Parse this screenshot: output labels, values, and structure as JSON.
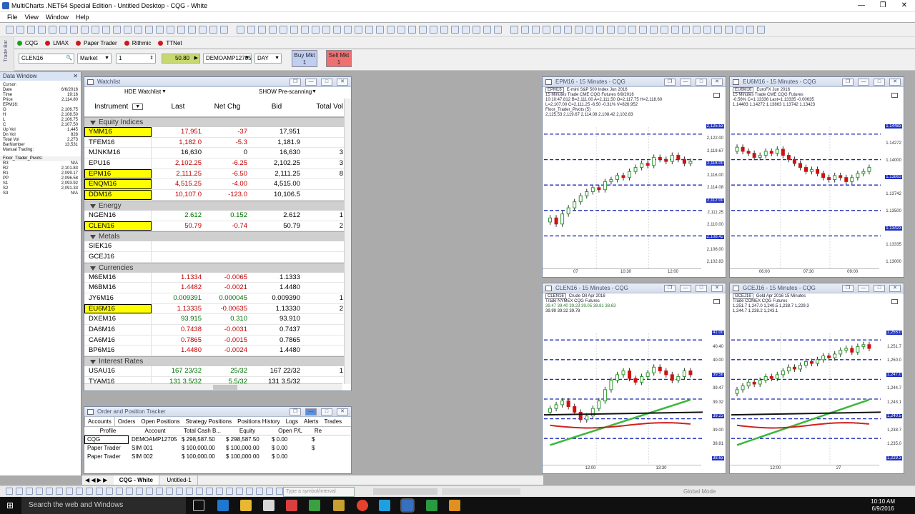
{
  "window": {
    "title": "MultiCharts .NET64 Special Edition - Untitled Desktop - CQG - White"
  },
  "menu": [
    "File",
    "View",
    "Window",
    "Help"
  ],
  "connections": [
    {
      "label": "CQG",
      "color": "#1aa020"
    },
    {
      "label": "LMAX",
      "color": "#d01818"
    },
    {
      "label": "Paper Trader",
      "color": "#d01818"
    },
    {
      "label": "Rithmic",
      "color": "#d01818"
    },
    {
      "label": "TTNet",
      "color": "#d01818"
    }
  ],
  "trade_bar": {
    "symbol": "CLEN16",
    "order_type": "Market",
    "quantity": "1",
    "price": "50.80",
    "account": "DEMOAMP12705",
    "tif": "DAY",
    "buy_label": "Buy Mkt",
    "buy_qty": "1",
    "sell_label": "Sell Mkt",
    "sell_qty": "1",
    "side_label": "Trade Bar"
  },
  "data_window": {
    "title": "Data Window",
    "rows": [
      {
        "k": "Cursor:",
        "v": ""
      },
      {
        "k": "Date",
        "v": "6/6/2016"
      },
      {
        "k": "Time",
        "v": "19:16"
      },
      {
        "k": "Price",
        "v": "2,114.80"
      },
      {
        "k": "EPM16:",
        "v": ""
      },
      {
        "k": "O",
        "v": "2,106.75"
      },
      {
        "k": "H",
        "v": "2,108.50"
      },
      {
        "k": "L",
        "v": "2,106.75"
      },
      {
        "k": "C",
        "v": "2,107.50"
      },
      {
        "k": "Up Vol",
        "v": "1,445"
      },
      {
        "k": "Dn Vol",
        "v": "828"
      },
      {
        "k": "Total Vol",
        "v": "2,273"
      },
      {
        "k": "BarNumber",
        "v": "13,531"
      },
      {
        "k": "Manual Trading:",
        "v": ""
      }
    ],
    "pivot_title": "Floor_Trader_Pivots:",
    "pivots": [
      {
        "k": "R3",
        "v": "N/A"
      },
      {
        "k": "R2",
        "v": "2,101.83"
      },
      {
        "k": "R1",
        "v": "2,099.17"
      },
      {
        "k": "PP",
        "v": "2,096.58"
      },
      {
        "k": "S1",
        "v": "2,093.92"
      },
      {
        "k": "S2",
        "v": "2,091.33"
      },
      {
        "k": "S3",
        "v": "N/A"
      }
    ]
  },
  "watchlist": {
    "title": "Watchlist",
    "name": "HDE Watchlist",
    "prescan": "SHOW Pre-scanning",
    "columns": [
      "Instrument",
      "Last",
      "Net Chg",
      "Bid",
      "Total Vol"
    ],
    "groups": [
      {
        "name": "Equity Indices",
        "rows": [
          {
            "inst": "YMM16",
            "last": "17,951",
            "chg": "-37",
            "bid": "17,951",
            "vol": "",
            "hl": true,
            "c": "red"
          },
          {
            "inst": "TFEM16",
            "last": "1,182.0",
            "chg": "-5.3",
            "bid": "1,181.9",
            "vol": "",
            "hl": false,
            "c": "red"
          },
          {
            "inst": "MJNKM16",
            "last": "16,630",
            "chg": "0",
            "bid": "16,630",
            "vol": "3",
            "hl": false,
            "c": ""
          },
          {
            "inst": "EPU16",
            "last": "2,102.25",
            "chg": "-6.25",
            "bid": "2,102.25",
            "vol": "3",
            "hl": false,
            "c": "red"
          },
          {
            "inst": "EPM16",
            "last": "2,111.25",
            "chg": "-6.50",
            "bid": "2,111.25",
            "vol": "8",
            "hl": true,
            "c": "red"
          },
          {
            "inst": "ENQM16",
            "last": "4,515.25",
            "chg": "-4.00",
            "bid": "4,515.00",
            "vol": "",
            "hl": true,
            "c": "red"
          },
          {
            "inst": "DDM16",
            "last": "10,107.0",
            "chg": "-123.0",
            "bid": "10,106.5",
            "vol": "",
            "hl": true,
            "c": "red"
          }
        ]
      },
      {
        "name": "Energy",
        "rows": [
          {
            "inst": "NGEN16",
            "last": "2.612",
            "chg": "0.152",
            "bid": "2.612",
            "vol": "1",
            "hl": false,
            "c": "grn"
          },
          {
            "inst": "CLEN16",
            "last": "50.79",
            "chg": "-0.74",
            "bid": "50.79",
            "vol": "2",
            "hl": true,
            "c": "red"
          }
        ]
      },
      {
        "name": "Metals",
        "rows": [
          {
            "inst": "SIEK16",
            "last": "",
            "chg": "",
            "bid": "",
            "vol": "",
            "hl": false,
            "c": ""
          },
          {
            "inst": "GCEJ16",
            "last": "",
            "chg": "",
            "bid": "",
            "vol": "",
            "hl": false,
            "c": ""
          }
        ]
      },
      {
        "name": "Currencies",
        "rows": [
          {
            "inst": "M6EM16",
            "last": "1.1334",
            "chg": "-0.0065",
            "bid": "1.1333",
            "vol": "",
            "hl": false,
            "c": "red"
          },
          {
            "inst": "M6BM16",
            "last": "1.4482",
            "chg": "-0.0021",
            "bid": "1.4480",
            "vol": "",
            "hl": false,
            "c": "red"
          },
          {
            "inst": "JY6M16",
            "last": "0.009391",
            "chg": "0.000045",
            "bid": "0.009390",
            "vol": "1",
            "hl": false,
            "c": "grn"
          },
          {
            "inst": "EU6M16",
            "last": "1.13335",
            "chg": "-0.00635",
            "bid": "1.13330",
            "vol": "2",
            "hl": true,
            "c": "red"
          },
          {
            "inst": "DXEM16",
            "last": "93.915",
            "chg": "0.310",
            "bid": "93.910",
            "vol": "",
            "hl": false,
            "c": "grn"
          },
          {
            "inst": "DA6M16",
            "last": "0.7438",
            "chg": "-0.0031",
            "bid": "0.7437",
            "vol": "",
            "hl": false,
            "c": "red"
          },
          {
            "inst": "CA6M16",
            "last": "0.7865",
            "chg": "-0.0015",
            "bid": "0.7865",
            "vol": "",
            "hl": false,
            "c": "red"
          },
          {
            "inst": "BP6M16",
            "last": "1.4480",
            "chg": "-0.0024",
            "bid": "1.4480",
            "vol": "",
            "hl": false,
            "c": "red"
          }
        ]
      },
      {
        "name": "Interest Rates",
        "rows": [
          {
            "inst": "USAU16",
            "last": "167 23/32",
            "chg": "25/32",
            "bid": "167 22/32",
            "vol": "1",
            "hl": false,
            "c": "grn"
          },
          {
            "inst": "TYAM16",
            "last": "131 3.5/32",
            "chg": "5.5/32",
            "bid": "131 3.5/32",
            "vol": "",
            "hl": false,
            "c": "grn"
          }
        ]
      }
    ]
  },
  "opt": {
    "title": "Order and Position Tracker",
    "tabs": [
      "Accounts",
      "Orders",
      "Open Positions",
      "Strategy Positions",
      "Positions History",
      "Logs",
      "Alerts",
      "Trades"
    ],
    "columns": [
      "Profile",
      "Account",
      "Total Cash B...",
      "Equity",
      "Open P/L",
      "Re"
    ],
    "rows": [
      [
        "CQG",
        "DEMOAMP12705",
        "$ 298,587.50",
        "$ 298,587.50",
        "$ 0.00",
        "$"
      ],
      [
        "Paper Trader",
        "SIM 001",
        "$ 100,000.00",
        "$ 100,000.00",
        "$ 0.00",
        "$"
      ],
      [
        "Paper Trader",
        "SIM 002",
        "$ 100,000.00",
        "$ 100,000.00",
        "$ 0.00",
        ""
      ]
    ]
  },
  "charts": [
    {
      "title": "EPM16 - 15 Minutes - CQG",
      "symbol": "EPM16",
      "desc": "E-mini S&P 500 Index Jun 2016",
      "line1": "15 Minutes  Trade  CME  CQG  Futures  6/9/2016",
      "line2": "10:10:47.812  B=2,111.00  A=2,111.50  O=2,117.75  H=2,118.60",
      "line3": "L=2,107.00  C=2,111.25  -6.50  -0.31%  V=826,952",
      "line4": "Floor_Trader_Pivots  (5)",
      "line5": "2,125.53  2,119.67  2,114.08  2,108.42  2,102.83",
      "price_labels": [
        "2,125.53",
        "2,122.00",
        "2,119.67",
        "2,118.00",
        "2,116.00",
        "2,114.08",
        "2,112.00",
        "2,111.25",
        "2,110.00",
        "2,108.42",
        "2,106.00",
        "2,102.83"
      ],
      "time_labels": [
        "07",
        "10:30",
        "12:00"
      ]
    },
    {
      "title": "EU6M16 - 15 Minutes - CQG",
      "symbol": "EU6M16",
      "desc": "EuroFX Jun 2016",
      "line1": "15 Minutes  Trade  CME  CQG  Futures",
      "line2": "-0.56%  C=1.13336  Last=1.13335  -0.00635",
      "line3": "1.14483  1.14272  1.13863  1.13742  1.13423",
      "line4": "",
      "line5": "",
      "price_labels": [
        "1.14483",
        "1.14272",
        "1.14000",
        "1.13863",
        "1.13742",
        "1.13500",
        "1.13423",
        "1.13335",
        "1.13000"
      ],
      "time_labels": [
        "06:00",
        "07:30",
        "09:00"
      ]
    },
    {
      "title": "CLEN16 - 15 Minutes - CQG",
      "symbol": "CLEN16",
      "desc": "Crude Oil Apr 2016",
      "line1": "Trade  NYMEX  CQG  Futures",
      "line2": "39.47  39.40  39.23  39.05  38.81  38.63",
      "line3": "39.99  39.32  39.78",
      "line4": "",
      "line5": "",
      "price_labels": [
        "41.00",
        "40.40",
        "40.00",
        "39.58",
        "39.47",
        "39.32",
        "39.23",
        "39.00",
        "38.81",
        "38.63"
      ],
      "time_labels": [
        "12:00",
        "13:30"
      ]
    },
    {
      "title": "GCEJ16 - 15 Minutes - CQG",
      "symbol": "GCEJ16",
      "desc": "Gold Apr 2016  15 Minutes",
      "line1": "Trade  COMEX  CQG  Futures",
      "line2": "1,251.7  1,247.0  1,240.5  1,238.7  1,229.3",
      "line3": "1,244.7  1,238.2  1,243.1",
      "line4": "",
      "line5": "",
      "price_labels": [
        "1,255.0",
        "1,251.7",
        "1,250.0",
        "1,247.0",
        "1,244.7",
        "1,243.1",
        "1,240.5",
        "1,238.7",
        "1,235.0",
        "1,229.3"
      ],
      "time_labels": [
        "12:00",
        "27"
      ]
    }
  ],
  "sheets": [
    "CQG - White",
    "Untitled-1"
  ],
  "status": {
    "symbol_placeholder": "Type a symbol/interval",
    "global_mode": "Global Mode"
  },
  "taskbar": {
    "search": "Search the web and Windows",
    "time": "10:10 AM",
    "date": "6/9/2016"
  }
}
